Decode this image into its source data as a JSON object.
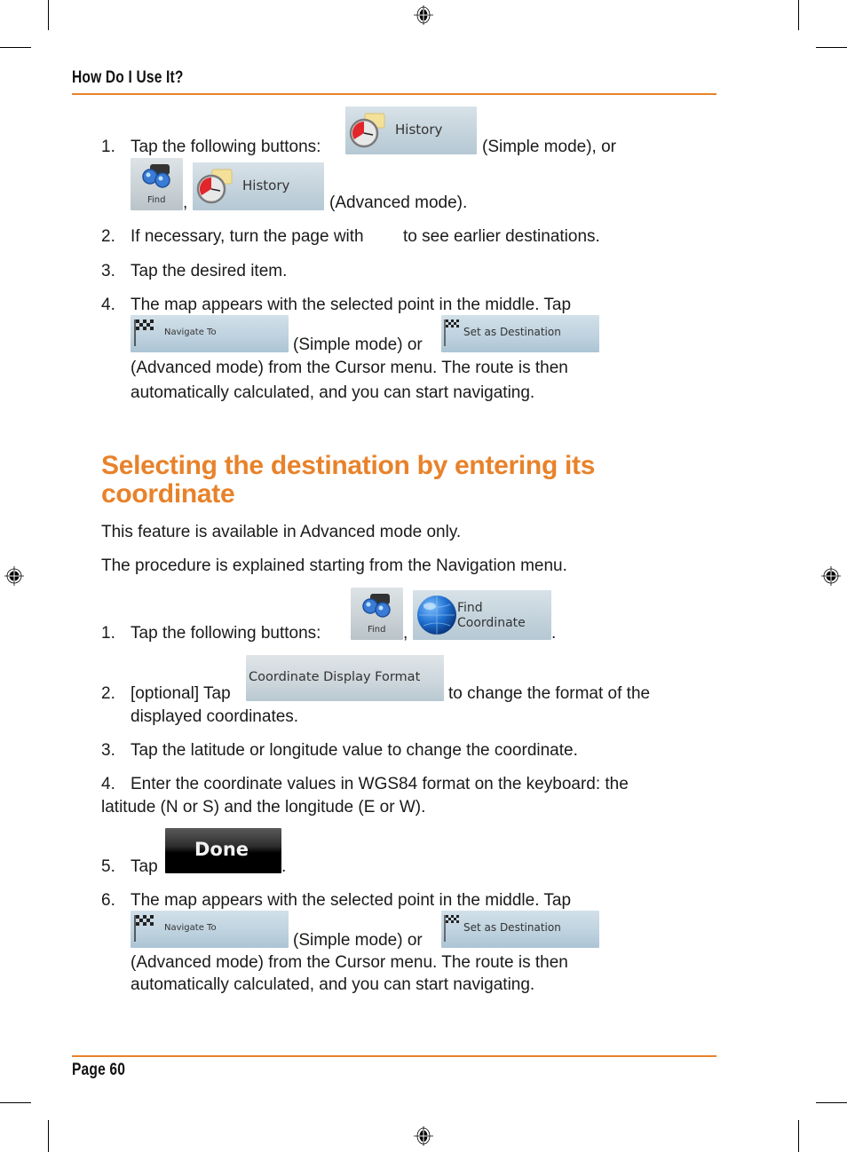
{
  "page": {
    "running_header": "How Do I Use It?",
    "footer": "Page 60",
    "accent_color": "#e8822a"
  },
  "section1": {
    "steps": [
      {
        "num": "1.",
        "text_a": "Tap the following buttons:",
        "text_b": "(Simple mode), or",
        "text_c": ",",
        "text_d": "(Advanced mode).",
        "buttons": {
          "history_simple": "History",
          "find": "Find",
          "history_advanced": "History"
        }
      },
      {
        "num": "2.",
        "text_a": "If necessary, turn the page with",
        "text_b": "to see earlier destinations."
      },
      {
        "num": "3.",
        "text": "Tap the desired item."
      },
      {
        "num": "4.",
        "line1": "The map appears with the selected point in the middle. Tap",
        "mid": "(Simple mode) or",
        "line3": "(Advanced mode) from the Cursor menu. The route is then",
        "line4": "automatically calculated, and you can start navigating.",
        "buttons": {
          "navigate_to": "Navigate To",
          "set_as_destination": "Set as Destination"
        }
      }
    ]
  },
  "section2": {
    "heading_line1": "Selecting the destination by entering its",
    "heading_line2": "coordinate",
    "intro1": "This feature is available in Advanced mode only.",
    "intro2": "The procedure is explained starting from the Navigation menu.",
    "steps": [
      {
        "num": "1.",
        "text_a": "Tap the following buttons:",
        "sep": ",",
        "end": ".",
        "buttons": {
          "find": "Find",
          "find_coordinate_l1": "Find",
          "find_coordinate_l2": "Coordinate"
        }
      },
      {
        "num": "2.",
        "text_a": "[optional] Tap",
        "text_b": "to change the format of the",
        "text_c": "displayed coordinates.",
        "buttons": {
          "coordinate_display_format": "Coordinate Display Format"
        }
      },
      {
        "num": "3.",
        "text": "Tap the latitude or longitude value to change the coordinate."
      },
      {
        "num": "4.",
        "line1": "Enter the coordinate values in WGS84 format on the keyboard: the",
        "line2": "latitude (N or S) and the longitude (E or W)."
      },
      {
        "num": "5.",
        "text_a": "Tap",
        "end": ".",
        "buttons": {
          "done": "Done"
        }
      },
      {
        "num": "6.",
        "line1": "The map appears with the selected point in the middle. Tap",
        "mid": "(Simple mode) or",
        "line3": "(Advanced mode) from the Cursor menu. The route is then",
        "line4": "automatically calculated, and you can start navigating.",
        "buttons": {
          "navigate_to": "Navigate To",
          "set_as_destination": "Set as Destination"
        }
      }
    ]
  }
}
